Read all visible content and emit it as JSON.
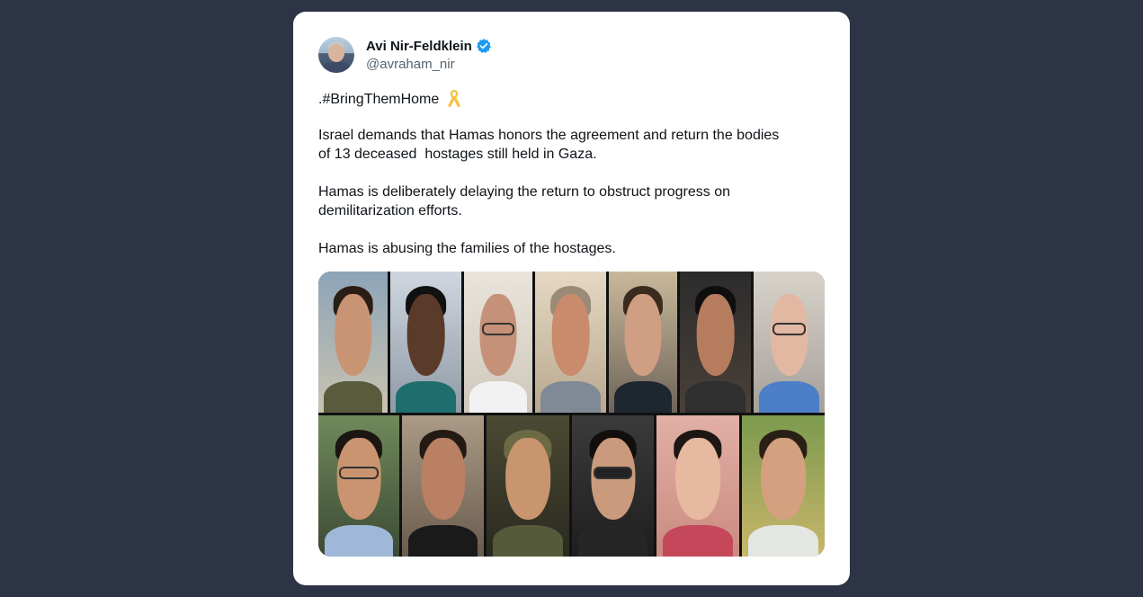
{
  "tweet": {
    "author_name": "Avi Nir-Feldklein",
    "handle": "@avraham_nir",
    "line1": ".#BringThemHome",
    "para1": "Israel demands that Hamas honors the agreement and return the bodies\nof 13 deceased  hostages still held in Gaza.",
    "para2": "Hamas is deliberately delaying the return to obstruct progress on\ndemilitarization efforts.",
    "para3": "Hamas is abusing the families of the hostages."
  },
  "icons": {
    "verified": "verified-badge-icon",
    "ribbon": "yellow-ribbon-icon"
  },
  "colors": {
    "page_bg": "#2d3446",
    "verified_blue": "#1d9bf0",
    "ribbon_yellow": "#f5c242",
    "handle_gray": "#536471"
  }
}
